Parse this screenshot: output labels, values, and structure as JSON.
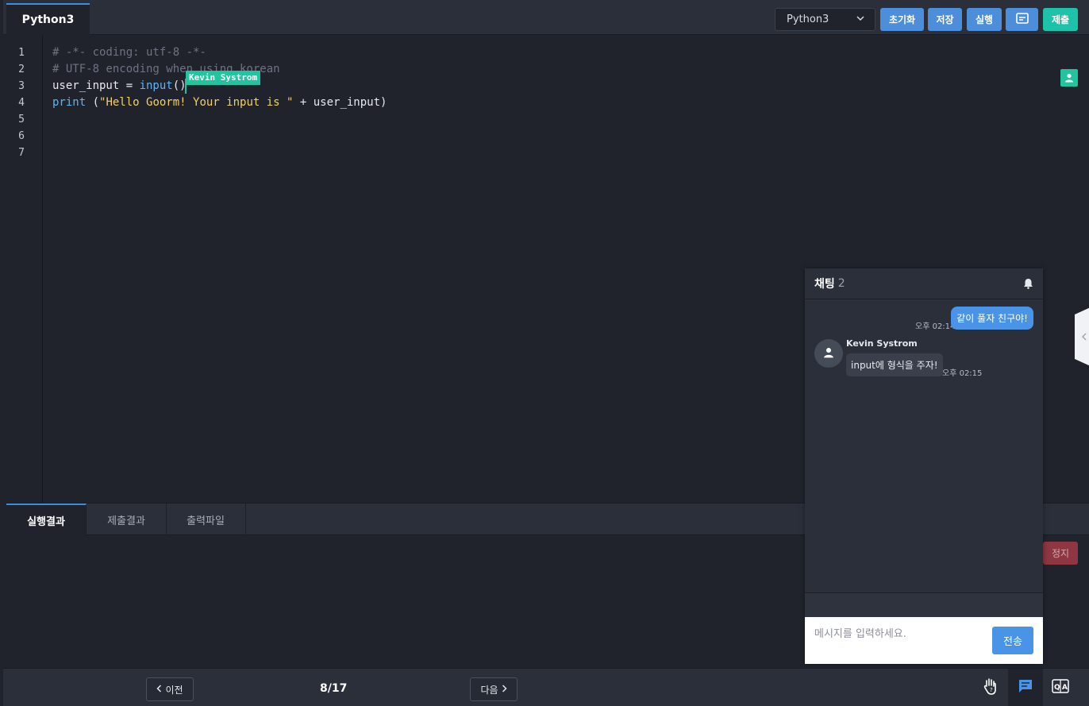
{
  "header": {
    "file_tab": "Python3",
    "language": "Python3",
    "buttons": {
      "reset": "초기화",
      "save": "저장",
      "run": "실행",
      "submit": "제출"
    }
  },
  "editor": {
    "line_numbers": [
      "1",
      "2",
      "3",
      "4",
      "5",
      "6",
      "7"
    ],
    "lines": {
      "l1": "# -*- coding: utf-8 -*-",
      "l2": "# UTF-8 encoding when using korean",
      "l3_a": "user_input = ",
      "l3_fn": "input",
      "l3_b": "()",
      "l4_fn": "print",
      "l4_a": " (",
      "l4_str": "\"Hello Goorm! Your input is \"",
      "l4_b": " + user_input)"
    },
    "cursor_user": "Kevin Systrom"
  },
  "bottom_tabs": [
    "실행결과",
    "제출결과",
    "출력파일"
  ],
  "stop_label": "정지",
  "footer": {
    "prev": "이전",
    "page": "8/17",
    "next": "다음"
  },
  "chat": {
    "title": "채팅",
    "count": "2",
    "messages": [
      {
        "text": "같이 풀자 친구야!",
        "time": "오후 02:14"
      },
      {
        "sender": "Kevin Systrom",
        "text": "input에 형식을 주자!",
        "time": "오후 02:15"
      }
    ],
    "placeholder": "메시지를 입력하세요.",
    "send": "전송"
  },
  "colors": {
    "accent_blue": "#4c8ed9",
    "accent_teal": "#1ec2a8",
    "stop_red": "#8e3641"
  }
}
